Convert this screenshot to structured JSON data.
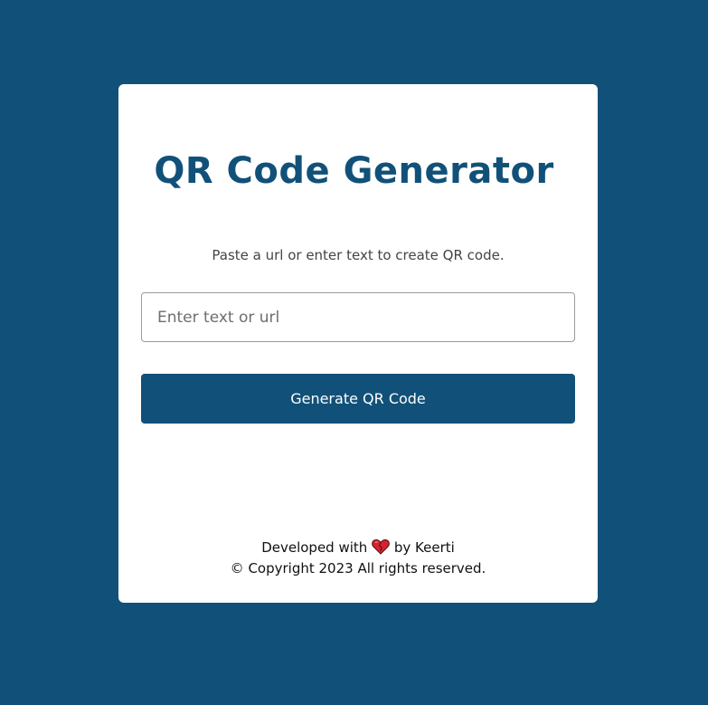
{
  "page": {
    "title": "QR Code Generator",
    "subtitle": "Paste a url or enter text to create QR code."
  },
  "form": {
    "input_placeholder": "Enter text or url",
    "input_value": "",
    "generate_label": "Generate QR Code"
  },
  "footer": {
    "developed_prefix": "Developed with",
    "developed_suffix": "by Keerti",
    "copyright": "© Copyright 2023 All rights reserved."
  },
  "colors": {
    "background": "#115179",
    "card": "#ffffff",
    "accent": "#115179"
  },
  "icons": {
    "heart": "heart-icon"
  }
}
